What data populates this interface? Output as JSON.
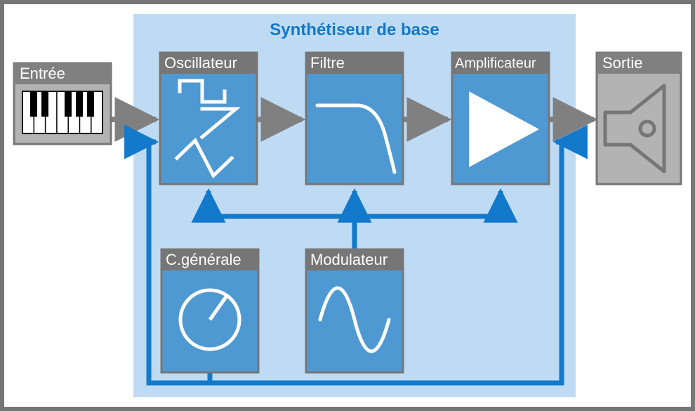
{
  "title": "Synthétiseur de base",
  "blocks": {
    "input": {
      "label": "Entrée"
    },
    "oscillator": {
      "label": "Oscillateur"
    },
    "filter": {
      "label": "Filtre"
    },
    "amplifier": {
      "label": "Amplificateur"
    },
    "output": {
      "label": "Sortie"
    },
    "global": {
      "label": "C.générale"
    },
    "modulator": {
      "label": "Modulateur"
    }
  },
  "colors": {
    "frame": "#767676",
    "panel_bg": "#bfdbf4",
    "grey_box": "#b3b3b3",
    "grey_head": "#808080",
    "blue_box": "#4f99d3",
    "blue_head": "#767676",
    "arrow_grey": "#808080",
    "arrow_blue": "#1279cb",
    "white": "#ffffff"
  },
  "chart_data": {
    "type": "diagram",
    "nodes": [
      {
        "id": "input",
        "label": "Entrée",
        "icon": "keyboard"
      },
      {
        "id": "oscillator",
        "label": "Oscillateur",
        "icon": "waveforms"
      },
      {
        "id": "filter",
        "label": "Filtre",
        "icon": "lowpass"
      },
      {
        "id": "amplifier",
        "label": "Amplificateur",
        "icon": "triangle"
      },
      {
        "id": "output",
        "label": "Sortie",
        "icon": "speaker"
      },
      {
        "id": "global",
        "label": "C.générale",
        "icon": "knob"
      },
      {
        "id": "modulator",
        "label": "Modulateur",
        "icon": "sine"
      }
    ],
    "edges_signal": [
      [
        "input",
        "oscillator"
      ],
      [
        "oscillator",
        "filter"
      ],
      [
        "filter",
        "amplifier"
      ],
      [
        "amplifier",
        "output"
      ]
    ],
    "edges_modulation": [
      [
        "modulator",
        "oscillator"
      ],
      [
        "modulator",
        "filter"
      ],
      [
        "modulator",
        "amplifier"
      ],
      [
        "global",
        "oscillator"
      ],
      [
        "global",
        "amplifier"
      ]
    ],
    "group": {
      "label": "Synthétiseur de base",
      "members": [
        "oscillator",
        "filter",
        "amplifier",
        "global",
        "modulator"
      ]
    }
  }
}
